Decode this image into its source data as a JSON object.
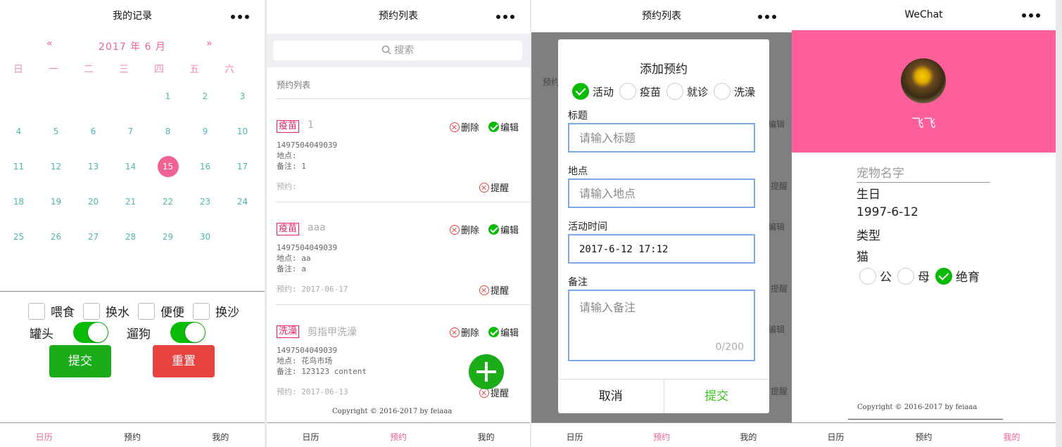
{
  "panel1": {
    "title": "我的记录",
    "month_title": "2017 年 6 月",
    "prev": "«",
    "next": "»",
    "weekdays": [
      "日",
      "一",
      "二",
      "三",
      "四",
      "五",
      "六"
    ],
    "days": [
      "",
      "",
      "",
      "",
      "1",
      "2",
      "3",
      "4",
      "5",
      "6",
      "7",
      "8",
      "9",
      "10",
      "11",
      "12",
      "13",
      "14",
      "15",
      "16",
      "17",
      "18",
      "19",
      "20",
      "21",
      "22",
      "23",
      "24",
      "25",
      "26",
      "27",
      "28",
      "29",
      "30",
      ""
    ],
    "selected_day": "15",
    "checkboxes": [
      "喂食",
      "换水",
      "便便",
      "换沙"
    ],
    "switches": [
      "罐头",
      "遛狗"
    ],
    "submit": "提交",
    "reset": "重置",
    "tabs": [
      "日历",
      "预约",
      "我的"
    ]
  },
  "panel2": {
    "title": "预约列表",
    "search_placeholder": "搜索",
    "list_title": "预约列表",
    "items": [
      {
        "tag": "疫苗",
        "title": "1",
        "id": "1497504049039",
        "place": "地点:",
        "note": "备注: 1",
        "appt": "预约:"
      },
      {
        "tag": "疫苗",
        "title": "aaa",
        "id": "1497504049039",
        "place": "地点: aa",
        "note": "备注: a",
        "appt": "预约: 2017-06-17"
      },
      {
        "tag": "洗澡",
        "title": "剪指甲洗澡",
        "id": "1497504049039",
        "place": "地点: 花鸟市场",
        "note": "备注: 123123 content",
        "appt": "预约: 2017-06-13"
      }
    ],
    "delete": "删除",
    "edit": "编辑",
    "remind": "提醒",
    "copyright": "Copyright © 2016-2017 by feiaaa",
    "tabs": [
      "日历",
      "预约",
      "我的"
    ]
  },
  "panel3": {
    "title": "预约列表",
    "modal_title": "添加预约",
    "types": [
      "活动",
      "疫苗",
      "就诊",
      "洗澡"
    ],
    "label_title": "标题",
    "ph_title": "请输入标题",
    "label_place": "地点",
    "ph_place": "请输入地点",
    "label_time": "活动时间",
    "time_value": "2017-6-12 17:12",
    "label_note": "备注",
    "ph_note": "请输入备注",
    "counter": "0/200",
    "cancel": "取消",
    "submit": "提交",
    "bg_list_title": "预约",
    "bg_edit": "编辑",
    "bg_remind": "提醒",
    "tabs": [
      "日历",
      "预约",
      "我的"
    ]
  },
  "panel4": {
    "title": "WeChat",
    "pet_name": "飞飞",
    "ph_pet_name": "宠物名字",
    "birthday_label": "生日",
    "birthday_value": "1997-6-12",
    "type_label": "类型",
    "type_value": "猫",
    "genders": [
      "公",
      "母",
      "绝育"
    ],
    "copyright": "Copyright © 2016-2017 by feiaaa",
    "tabs": [
      "日历",
      "预约",
      "我的"
    ]
  },
  "colors": {
    "accent_pink": "#f06292",
    "banner_pink": "#ff5f99",
    "green": "#1aad19",
    "red": "#e64340",
    "teal_days": "#4db6ac"
  }
}
